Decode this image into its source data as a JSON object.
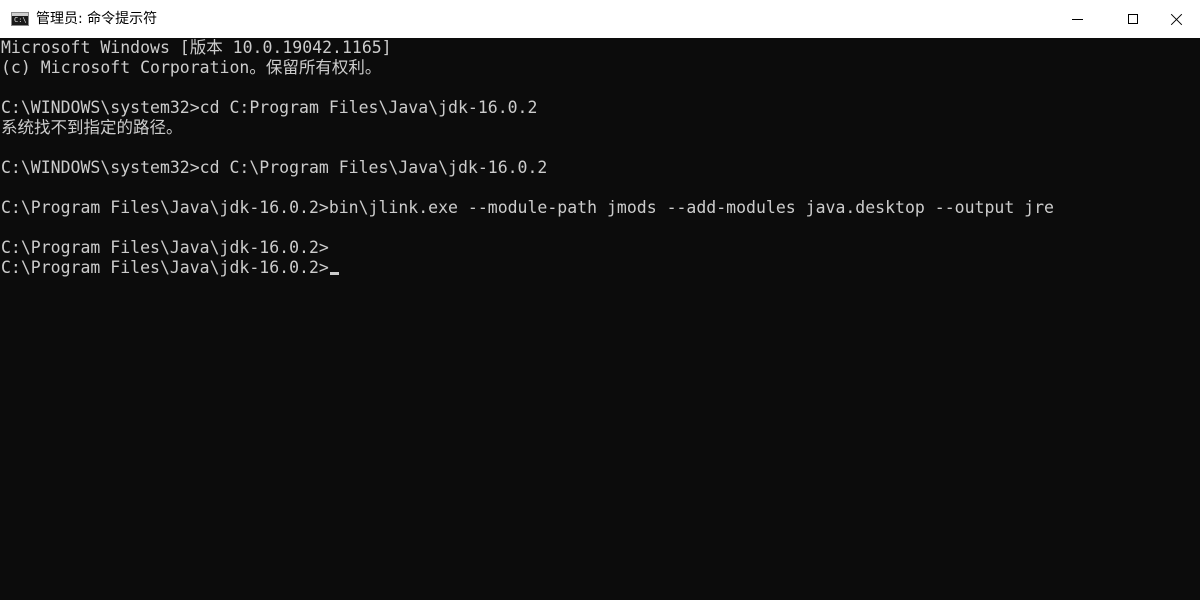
{
  "window": {
    "title": "管理员: 命令提示符",
    "icon": "cmd-icon",
    "icon_label": "C:\\",
    "controls": [
      "minimize-icon",
      "maximize-icon",
      "close-icon"
    ]
  },
  "console": {
    "lines": [
      "Microsoft Windows [版本 10.0.19042.1165]",
      "(c) Microsoft Corporation。保留所有权利。",
      "",
      "C:\\WINDOWS\\system32>cd C:Program Files\\Java\\jdk-16.0.2",
      "系统找不到指定的路径。",
      "",
      "C:\\WINDOWS\\system32>cd C:\\Program Files\\Java\\jdk-16.0.2",
      "",
      "C:\\Program Files\\Java\\jdk-16.0.2>bin\\jlink.exe --module-path jmods --add-modules java.desktop --output jre",
      "",
      "C:\\Program Files\\Java\\jdk-16.0.2>",
      "C:\\Program Files\\Java\\jdk-16.0.2>"
    ]
  },
  "colors": {
    "background": "#0c0c0c",
    "text": "#cccccc",
    "titlebar": "#ffffff"
  }
}
